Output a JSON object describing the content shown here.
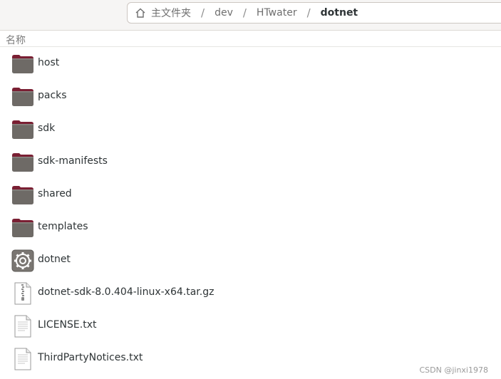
{
  "pathbar": {
    "home": "主文件夹",
    "segments": [
      "dev",
      "HTwater"
    ],
    "current": "dotnet"
  },
  "list_header": {
    "name_column": "名称"
  },
  "files": [
    {
      "name": "host",
      "icon": "folder-icon"
    },
    {
      "name": "packs",
      "icon": "folder-icon"
    },
    {
      "name": "sdk",
      "icon": "folder-icon"
    },
    {
      "name": "sdk-manifests",
      "icon": "folder-icon"
    },
    {
      "name": "shared",
      "icon": "folder-icon"
    },
    {
      "name": "templates",
      "icon": "folder-icon"
    },
    {
      "name": "dotnet",
      "icon": "executable-gear-icon"
    },
    {
      "name": "dotnet-sdk-8.0.404-linux-x64.tar.gz",
      "icon": "archive-icon"
    },
    {
      "name": "LICENSE.txt",
      "icon": "text-file-icon"
    },
    {
      "name": "ThirdPartyNotices.txt",
      "icon": "text-file-icon"
    }
  ],
  "watermark": "CSDN @jinxi1978",
  "colors": {
    "folder_body": "#6e6a66",
    "folder_tab": "#7a1f33",
    "text": "#2e3436"
  }
}
